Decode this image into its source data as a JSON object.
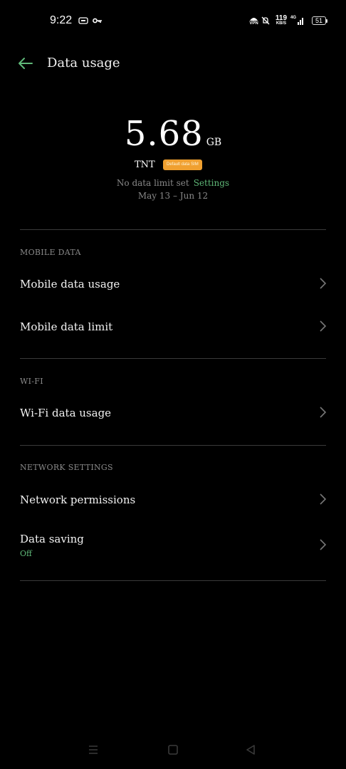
{
  "status_bar": {
    "time": "9:22",
    "net_speed_value": "119",
    "net_speed_unit": "KB/S",
    "vpn_label": "VPN",
    "network_label": "4G",
    "battery": "51"
  },
  "header": {
    "title": "Data usage"
  },
  "summary": {
    "value": "5.68",
    "unit": "GB",
    "carrier": "TNT",
    "sim_badge": "Default data SIM",
    "limit_text": "No data limit set",
    "settings_link": "Settings",
    "period": "May 13 – Jun 12"
  },
  "sections": {
    "mobile_data": {
      "header": "MOBILE DATA",
      "items": [
        "Mobile data usage",
        "Mobile data limit"
      ]
    },
    "wifi": {
      "header": "WI-FI",
      "items": [
        "Wi-Fi data usage"
      ]
    },
    "network_settings": {
      "header": "NETWORK SETTINGS",
      "items": [
        "Network permissions",
        "Data saving"
      ],
      "data_saving_status": "Off"
    }
  },
  "icons": {
    "accent_color": "#5fb878",
    "badge_color": "#f0a030",
    "back": "arrow-left-icon",
    "chevron": "chevron-right-icon"
  }
}
